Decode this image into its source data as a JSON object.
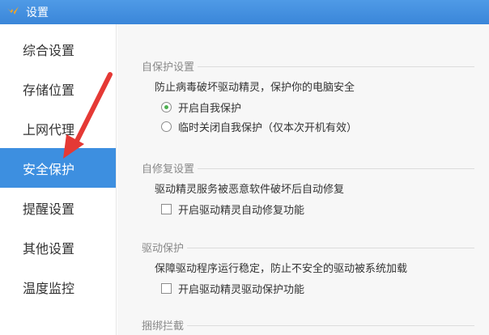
{
  "window": {
    "title": "设置"
  },
  "sidebar": {
    "items": [
      {
        "label": "综合设置",
        "active": false
      },
      {
        "label": "存储位置",
        "active": false
      },
      {
        "label": "上网代理",
        "active": false
      },
      {
        "label": "安全保护",
        "active": true
      },
      {
        "label": "提醒设置",
        "active": false
      },
      {
        "label": "其他设置",
        "active": false
      },
      {
        "label": "温度监控",
        "active": false
      }
    ]
  },
  "sections": {
    "self_protect": {
      "title": "自保护设置",
      "desc": "防止病毒破坏驱动精灵，保护你的电脑安全",
      "options": [
        {
          "label": "开启自我保护",
          "selected": true
        },
        {
          "label": "临时关闭自我保护（仅本次开机有效）",
          "selected": false
        }
      ]
    },
    "self_repair": {
      "title": "自修复设置",
      "desc": "驱动精灵服务被恶意软件破坏后自动修复",
      "checkbox": {
        "label": "开启驱动精灵自动修复功能",
        "checked": false
      }
    },
    "driver_protect": {
      "title": "驱动保护",
      "desc": "保障驱动程序运行稳定，防止不安全的驱动被系统加载",
      "checkbox": {
        "label": "开启驱动精灵驱动保护功能",
        "checked": false
      }
    },
    "bundle_block": {
      "title": "捆绑拦截"
    }
  },
  "colors": {
    "titlebar": "#3a86d9",
    "active_nav": "#3d8fe0",
    "radio_dot": "#4caf50",
    "arrow": "#e53935"
  }
}
